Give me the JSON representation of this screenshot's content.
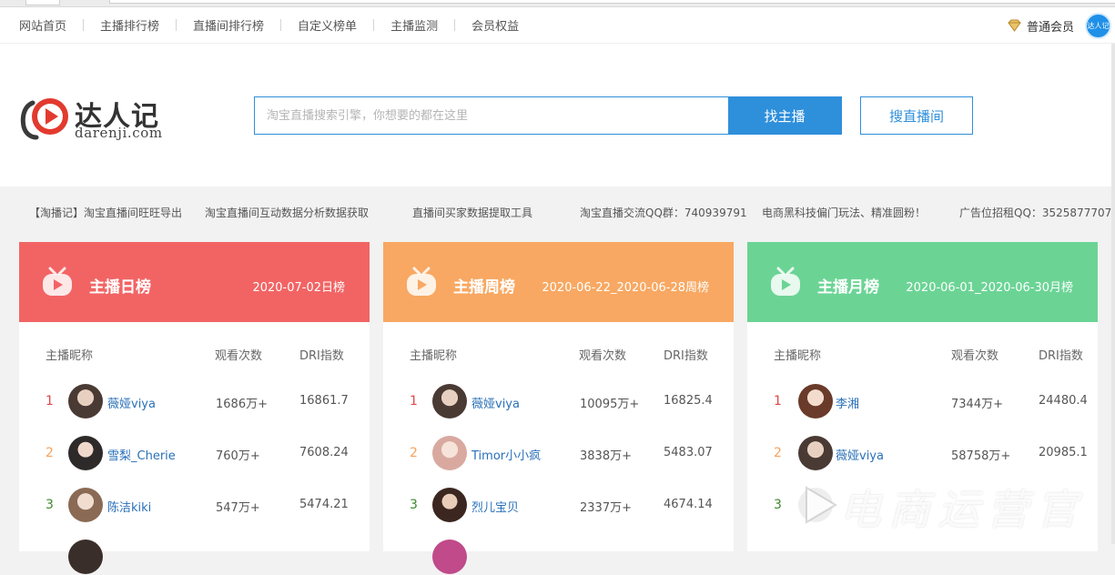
{
  "nav": {
    "items": [
      "网站首页",
      "主播排行榜",
      "直播间排行榜",
      "自定义榜单",
      "主播监测",
      "会员权益"
    ],
    "member_label": "普通会员",
    "avatar_text": "达人记"
  },
  "header": {
    "logo_cn": "达人记",
    "logo_en": "darenji.com",
    "search_placeholder": "淘宝直播搜索引擎，你想要的都在这里",
    "search_button": "找主播",
    "room_button": "搜直播间"
  },
  "ticker": [
    "【淘播记】淘宝直播间旺旺导出",
    "淘宝直播间互动数据分析数据获取",
    "直播间买家数据提取工具",
    "淘宝直播交流QQ群：740939791",
    "电商黑科技偏门玩法、精准圆粉！",
    "广告位招租QQ：3525877707"
  ],
  "columns": {
    "name": "主播昵称",
    "views": "观看次数",
    "dri": "DRI指数"
  },
  "boards": [
    {
      "title": "主播日榜",
      "period": "2020-07-02日榜",
      "color": "#f26464",
      "rows": [
        {
          "rank": "1",
          "name": "薇娅viya",
          "views": "1686万+",
          "dri": "16861.7"
        },
        {
          "rank": "2",
          "name": "雪梨_Cherie",
          "views": "760万+",
          "dri": "7608.24"
        },
        {
          "rank": "3",
          "name": "陈洁kiki",
          "views": "547万+",
          "dri": "5474.21"
        }
      ]
    },
    {
      "title": "主播周榜",
      "period": "2020-06-22_2020-06-28周榜",
      "color": "#f8a862",
      "rows": [
        {
          "rank": "1",
          "name": "薇娅viya",
          "views": "10095万+",
          "dri": "16825.4"
        },
        {
          "rank": "2",
          "name": "Timor小小疯",
          "views": "3838万+",
          "dri": "5483.07"
        },
        {
          "rank": "3",
          "name": "烈儿宝贝",
          "views": "2337万+",
          "dri": "4674.14"
        }
      ]
    },
    {
      "title": "主播月榜",
      "period": "2020-06-01_2020-06-30月榜",
      "color": "#6bd495",
      "rows": [
        {
          "rank": "1",
          "name": "李湘",
          "views": "7344万+",
          "dri": "24480.4"
        },
        {
          "rank": "2",
          "name": "薇娅viya",
          "views": "58758万+",
          "dri": "20985.1"
        },
        {
          "rank": "3",
          "name": "",
          "views": "",
          "dri": ""
        }
      ]
    }
  ],
  "watermark": "电商运营官"
}
